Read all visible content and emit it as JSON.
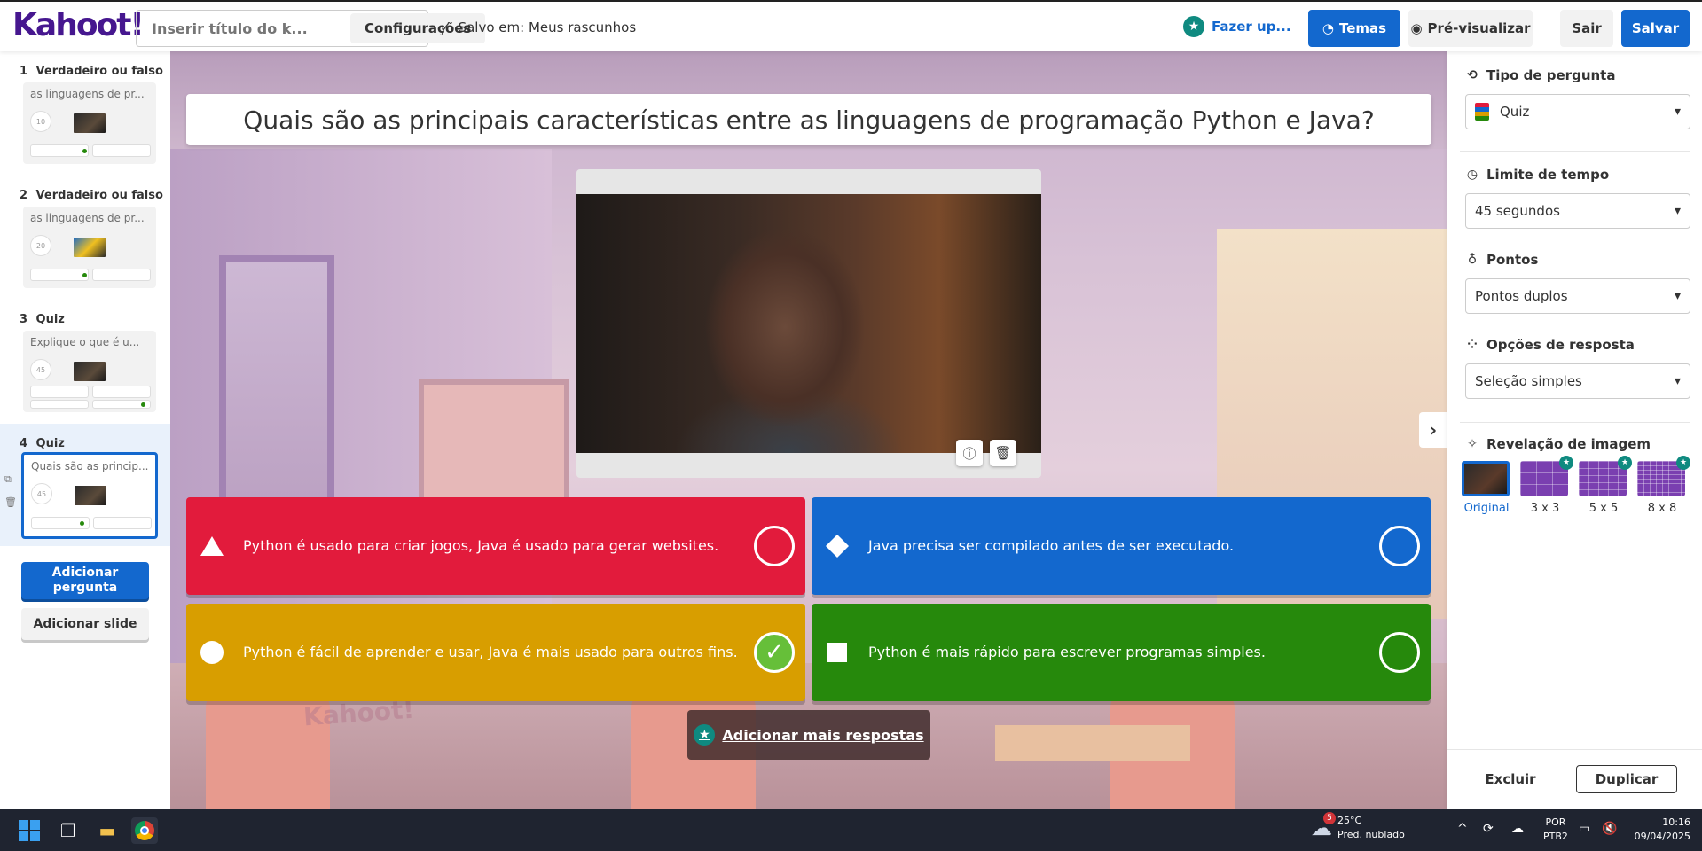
{
  "app": {
    "logo": "Kahoot!",
    "title_placeholder": "Inserir título do k...",
    "settings_label": "Configurações",
    "saved_text": "Salvo em: Meus rascunhos",
    "upgrade_label": "Fazer up...",
    "themes_label": "Temas",
    "preview_label": "Pré-visualizar",
    "exit_label": "Sair",
    "save_label": "Salvar"
  },
  "sidebar": {
    "slides": [
      {
        "num": "1",
        "type": "Verdadeiro ou falso",
        "text": "as linguagens de pr...",
        "timer": "10"
      },
      {
        "num": "2",
        "type": "Verdadeiro ou falso",
        "text": "as linguagens de pr...",
        "timer": "20"
      },
      {
        "num": "3",
        "type": "Quiz",
        "text": "Explique o que é u...",
        "timer": "45"
      },
      {
        "num": "4",
        "type": "Quiz",
        "text": "Quais são as princip...",
        "timer": "45"
      }
    ],
    "add_question_label": "Adicionar pergunta",
    "add_slide_label": "Adicionar slide"
  },
  "editor": {
    "question": "Quais são as principais características entre as linguagens de programação Python e Java?",
    "answers": [
      {
        "text": "Python é usado  para criar jogos, Java é usado para gerar websites.",
        "color": "#e21b3c",
        "shape": "triangle",
        "correct": false
      },
      {
        "text": "Java precisa ser compilado antes de ser executado.",
        "color": "#1368ce",
        "shape": "diamond",
        "correct": false
      },
      {
        "text": "Python é fácil de aprender e usar,  Java é mais usado para outros fins.",
        "color": "#d89e00",
        "shape": "circle",
        "correct": true
      },
      {
        "text": "Python é mais rápido para escrever programas simples.",
        "color": "#26890c",
        "shape": "square",
        "correct": false
      }
    ],
    "add_more_answers_label": "Adicionar mais respostas",
    "background_watermark": "Kahoot!"
  },
  "panel": {
    "question_type_label": "Tipo de pergunta",
    "question_type_value": "Quiz",
    "time_limit_label": "Limite de tempo",
    "time_limit_value": "45 segundos",
    "points_label": "Pontos",
    "points_value": "Pontos duplos",
    "answer_options_label": "Opções de resposta",
    "answer_options_value": "Seleção simples",
    "image_reveal_label": "Revelação de imagem",
    "reveal_options": [
      "Original",
      "3 x 3",
      "5 x 5",
      "8 x 8"
    ],
    "delete_label": "Excluir",
    "duplicate_label": "Duplicar"
  },
  "taskbar": {
    "weather_badge": "5",
    "temperature": "25°C",
    "weather_desc": "Pred. nublado",
    "lang": "POR",
    "layout": "PTB2",
    "time": "10:16",
    "date": "09/04/2025"
  }
}
